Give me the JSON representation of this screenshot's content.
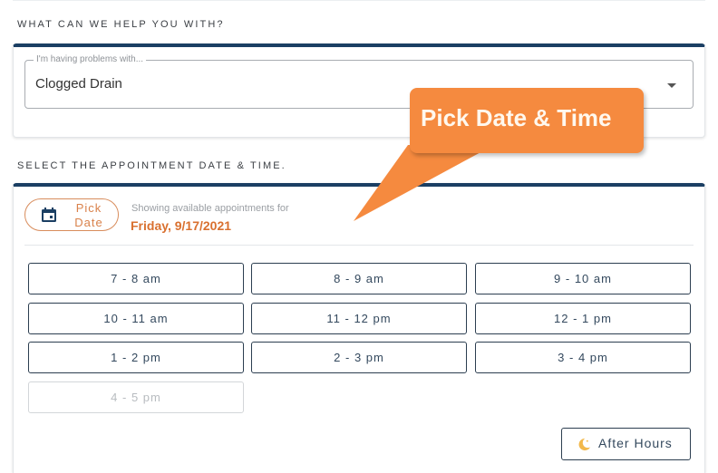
{
  "section1": {
    "heading": "WHAT CAN WE HELP YOU WITH?",
    "problem_select": {
      "label": "I'm having problems with...",
      "value": "Clogged Drain"
    }
  },
  "section2": {
    "heading": "SELECT THE APPOINTMENT DATE & TIME.",
    "pick_date_button": {
      "line1": "Pick",
      "line2": "Date",
      "icon": "calendar-icon"
    },
    "showing_text": "Showing available appointments for",
    "selected_date": "Friday, 9/17/2021",
    "time_slots": [
      {
        "label": "7 - 8 am",
        "available": true
      },
      {
        "label": "8 - 9 am",
        "available": true
      },
      {
        "label": "9 - 10 am",
        "available": true
      },
      {
        "label": "10 - 11 am",
        "available": true
      },
      {
        "label": "11 - 12 pm",
        "available": true
      },
      {
        "label": "12 - 1 pm",
        "available": true
      },
      {
        "label": "1 - 2 pm",
        "available": true
      },
      {
        "label": "2 - 3 pm",
        "available": true
      },
      {
        "label": "3 - 4 pm",
        "available": true
      },
      {
        "label": "4 - 5 pm",
        "available": false
      }
    ],
    "after_hours_button": {
      "label": "After Hours",
      "icon": "moon-icon"
    }
  },
  "callout": {
    "text": "Pick Date & Time"
  },
  "colors": {
    "primary_navy": "#1b3f63",
    "accent_orange": "#d9702f",
    "callout_orange": "#f58a3f"
  }
}
